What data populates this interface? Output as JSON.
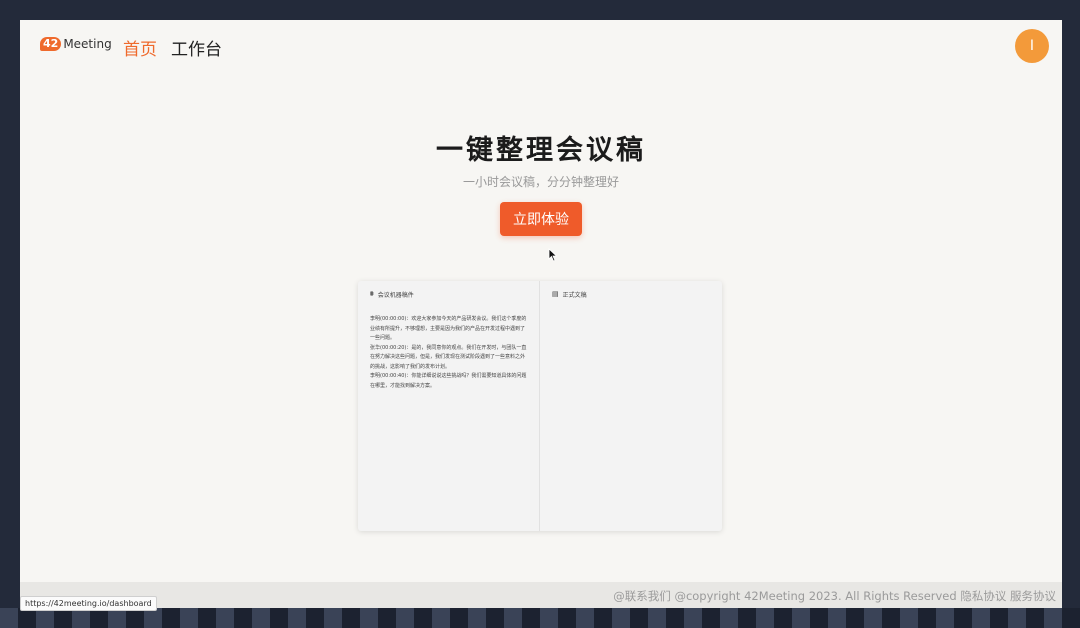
{
  "app": {
    "logo_badge": "42",
    "logo_text": "Meeting"
  },
  "nav": {
    "home": "首页",
    "workspace": "工作台",
    "avatar_initial": "I"
  },
  "hero": {
    "title": "一键整理会议稿",
    "subtitle": "一小时会议稿，分分钟整理好",
    "cta": "立即体验"
  },
  "preview": {
    "left_title": "会议机器稿件",
    "right_title": "正式文稿",
    "transcript": [
      "李明(00:00:00)：欢迎大家参加今天的产品研发会议。我们这个季度的业绩有所提升，不够理想，主要是因为我们的产品在开发过程中遇到了一些问题。",
      "张华(00:00:20)：是的，我同意你的观点。我们在开发时，与团队一直在努力解决这些问题，但是，我们发现在测试阶段遇到了一些意料之外的挑战，这影响了我们的发布计划。",
      "李明(00:00:40)：你能详细说说这些挑战吗？我们需要知道具体的问题在哪里，才能找到解决方案。"
    ]
  },
  "footer": {
    "contact": "@联系我们",
    "copyright": "@copyright 42Meeting 2023. All Rights Reserved",
    "privacy": "隐私协议",
    "terms": "服务协议"
  },
  "status_bar": {
    "url": "https://42meeting.io/dashboard"
  },
  "colors": {
    "accent": "#ef5b2a",
    "avatar": "#f39a3a",
    "page_bg": "#f7f6f3",
    "desktop_bg": "#232a3a"
  }
}
